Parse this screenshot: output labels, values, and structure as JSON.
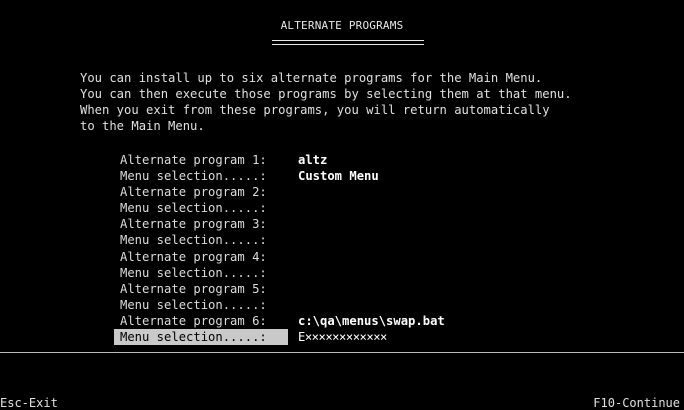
{
  "screen": {
    "title": "ALTERNATE PROGRAMS",
    "intro_lines": [
      "You can install up to six alternate programs for the Main Menu.",
      "You can then execute those programs by selecting them at that menu.",
      "When you exit from these programs, you will return automatically",
      "to the Main Menu."
    ]
  },
  "form": {
    "program_label_1": "Alternate program 1:",
    "program_value_1": "altz",
    "menu_label_1": "Menu selection.....:",
    "menu_value_1": "Custom Menu",
    "program_label_2": "Alternate program 2:",
    "program_value_2": "",
    "menu_label_2": "Menu selection.....:",
    "menu_value_2": "",
    "program_label_3": "Alternate program 3:",
    "program_value_3": "",
    "menu_label_3": "Menu selection.....:",
    "menu_value_3": "",
    "program_label_4": "Alternate program 4:",
    "program_value_4": "",
    "menu_label_4": "Menu selection.....:",
    "menu_value_4": "",
    "program_label_5": "Alternate program 5:",
    "program_value_5": "",
    "menu_label_5": "Menu selection.....:",
    "menu_value_5": "",
    "program_label_6": "Alternate program 6:",
    "program_value_6": "c:\\qa\\menus\\swap.bat",
    "menu_label_6": "Menu selection.....:",
    "menu_value_6": "E××××××××××××"
  },
  "footer": {
    "left_key": "Esc-Exit",
    "right_key": "F10-Continue"
  },
  "colors": {
    "background": "#000000",
    "text": "#dcdcdc",
    "highlight": "#c9c9c9"
  }
}
